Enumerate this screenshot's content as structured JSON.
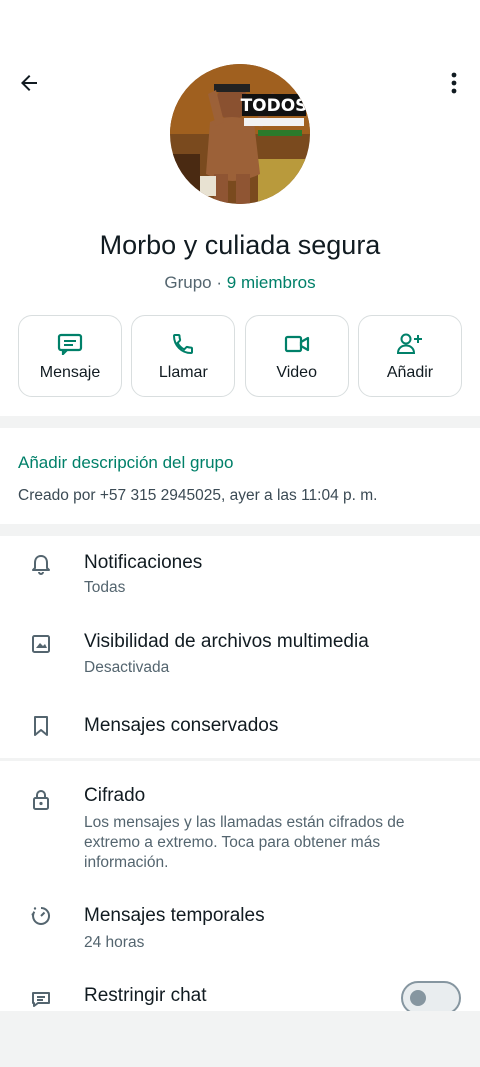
{
  "header": {
    "group_name": "Morbo y culiada segura",
    "group_type": "Grupo",
    "separator": "·",
    "members": "9 miembros",
    "avatar_overlay_text": "TODOS"
  },
  "actions": [
    {
      "label": "Mensaje",
      "icon": "message-icon"
    },
    {
      "label": "Llamar",
      "icon": "phone-icon"
    },
    {
      "label": "Video",
      "icon": "video-icon"
    },
    {
      "label": "Añadir",
      "icon": "add-person-icon"
    }
  ],
  "description": {
    "add_label": "Añadir descripción del grupo",
    "created_text": "Creado por +57 315 2945025, ayer a las 11:04 p. m."
  },
  "settings": {
    "notifications": {
      "title": "Notificaciones",
      "value": "Todas"
    },
    "media_visibility": {
      "title": "Visibilidad de archivos multimedia",
      "value": "Desactivada"
    },
    "kept_messages": {
      "title": "Mensajes conservados"
    },
    "encryption": {
      "title": "Cifrado",
      "description": "Los mensajes y las llamadas están cifrados de extremo a extremo. Toca para obtener más información."
    },
    "disappearing": {
      "title": "Mensajes temporales",
      "value": "24 horas"
    },
    "restrict_chat": {
      "title": "Restringir chat",
      "enabled": false
    }
  },
  "colors": {
    "accent": "#008069",
    "text_primary": "#111b21",
    "text_secondary": "#54656f",
    "background": "#f2f3f3"
  }
}
